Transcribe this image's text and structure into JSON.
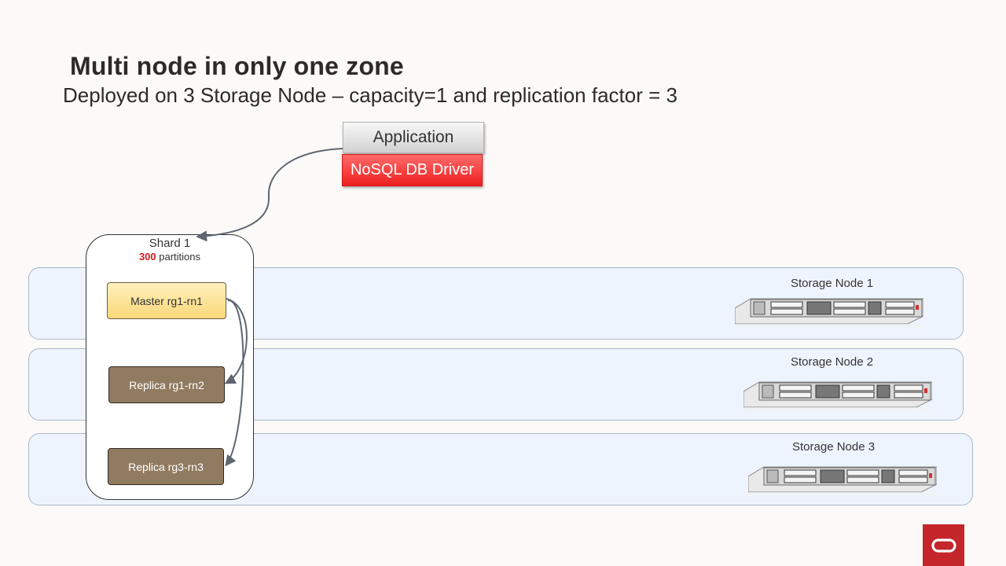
{
  "title": "Multi node in only one zone",
  "subtitle": "Deployed on 3 Storage Node – capacity=1 and replication factor = 3",
  "application": {
    "label": "Application",
    "driver_label": "NoSQL DB Driver"
  },
  "shard": {
    "title": "Shard 1",
    "partitions_count": "300",
    "partitions_label": " partitions",
    "master": {
      "label": "Master rg1-rn1"
    },
    "replicas": [
      {
        "label": "Replica rg1-rn2"
      },
      {
        "label": "Replica  rg3-rn3"
      }
    ]
  },
  "storage_nodes": [
    {
      "label": "Storage Node 1"
    },
    {
      "label": "Storage Node 2"
    },
    {
      "label": "Storage Node 3"
    }
  ],
  "colors": {
    "driver": "#ee1f1f",
    "partitions_count": "#d0191a",
    "master_fill": "#fbd879",
    "replica_fill": "#917b60",
    "band_fill": "#eef4fd",
    "logo": "#c4262b"
  },
  "icons": {
    "server": "rack-server-icon",
    "logo": "oracle-logo-icon"
  }
}
